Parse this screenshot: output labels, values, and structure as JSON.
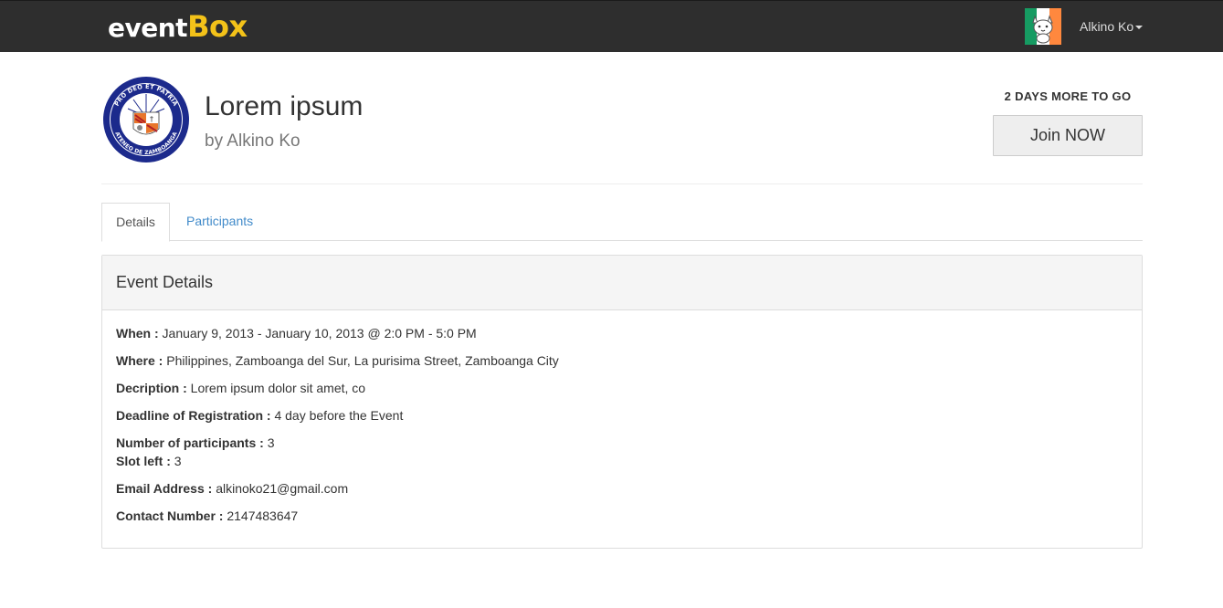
{
  "brand": {
    "word1": "event",
    "word2": "Box"
  },
  "user": {
    "name": "Alkino Ko"
  },
  "event": {
    "title": "Lorem ipsum",
    "author": "by Alkino Ko",
    "countdown": "2 DAYS MORE TO GO",
    "join_label": "Join NOW"
  },
  "tabs": {
    "details": "Details",
    "participants": "Participants"
  },
  "panel": {
    "heading": "Event Details",
    "rows": [
      {
        "label": "When :",
        "value": "January 9, 2013 - January 10, 2013 @ 2:0 PM - 5:0 PM"
      },
      {
        "label": "Where :",
        "value": "Philippines, Zamboanga del Sur, La purisima Street, Zamboanga City"
      },
      {
        "label": "Decription :",
        "value": "Lorem ipsum dolor sit amet, co"
      },
      {
        "label": "Deadline of Registration :",
        "value": "4 day before the Event"
      },
      {
        "label": "Number of participants :",
        "value": "3"
      },
      {
        "label": "Slot left :",
        "value": "3"
      },
      {
        "label": "Email Address :",
        "value": "alkinoko21@gmail.com"
      },
      {
        "label": "Contact Number :",
        "value": "2147483647"
      }
    ]
  },
  "logo": {
    "ring_text_top": "PRO DEO ET PATRIA",
    "ring_text_bottom": "ATENEO DE ZAMBOANGA"
  },
  "colors": {
    "navbar_bg": "#2e2e2e",
    "brand_accent": "#f3c219",
    "link": "#428bca",
    "seal_blue": "#1c2a8c"
  }
}
